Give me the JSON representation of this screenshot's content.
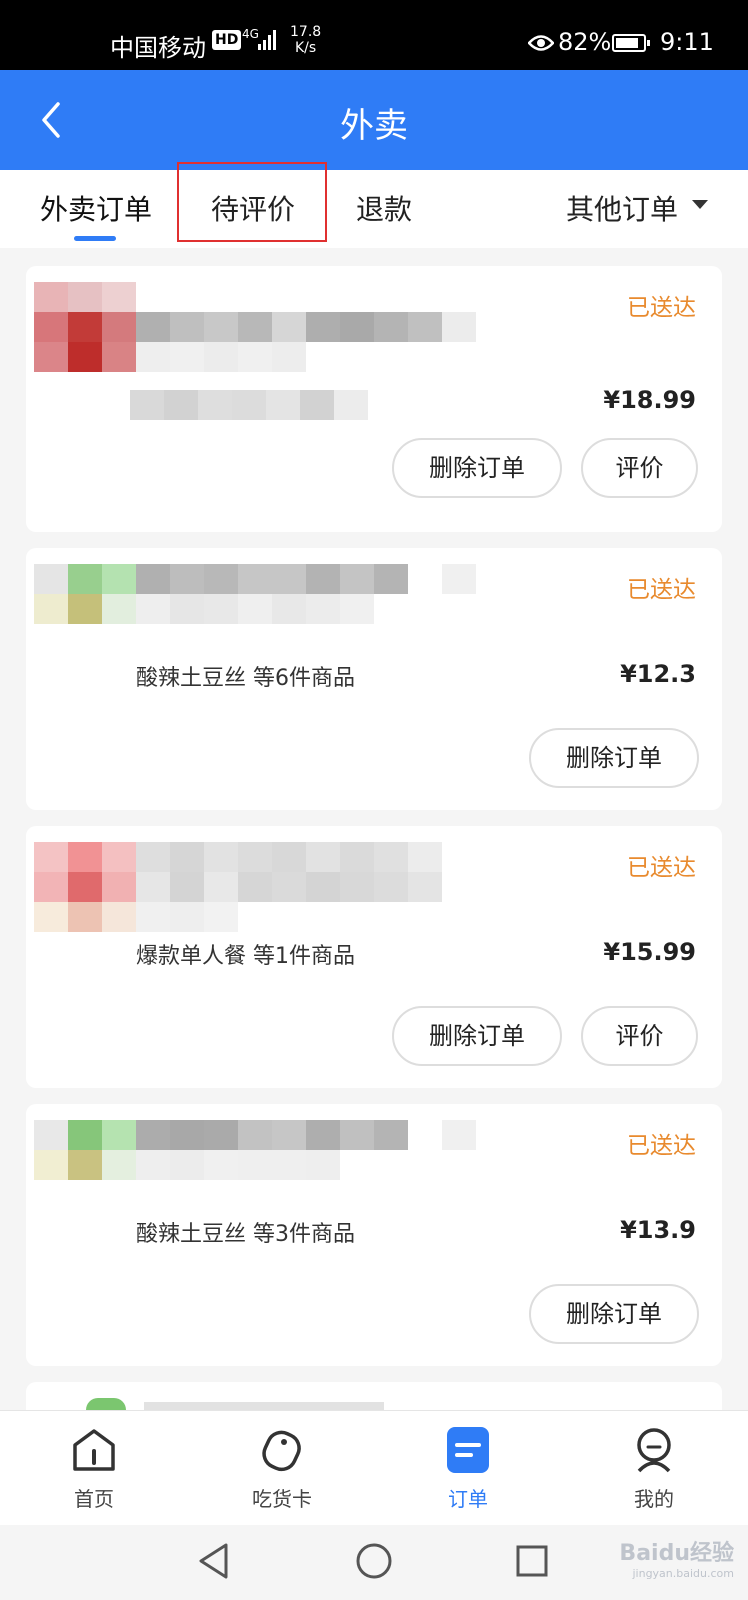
{
  "status_bar": {
    "carrier": "中国移动",
    "hd": "HD",
    "network": "4G",
    "speed_value": "17.8",
    "speed_unit": "K/s",
    "battery": "82%",
    "time": "9:11"
  },
  "header": {
    "title": "外卖"
  },
  "tabs": {
    "items": [
      {
        "label": "外卖订单"
      },
      {
        "label": "待评价"
      },
      {
        "label": "退款"
      }
    ],
    "more_label": "其他订单"
  },
  "orders": [
    {
      "status": "已送达",
      "goods": "",
      "price": "¥18.99",
      "delete_label": "删除订单",
      "review_label": "评价"
    },
    {
      "status": "已送达",
      "goods": "酸辣土豆丝 等6件商品",
      "price": "¥12.3",
      "delete_label": "删除订单"
    },
    {
      "status": "已送达",
      "goods": "爆款单人餐 等1件商品",
      "price": "¥15.99",
      "delete_label": "删除订单",
      "review_label": "评价"
    },
    {
      "status": "已送达",
      "goods": "酸辣土豆丝 等3件商品",
      "price": "¥13.9",
      "delete_label": "删除订单"
    }
  ],
  "bottom_nav": {
    "items": [
      {
        "label": "首页",
        "icon": "home-icon"
      },
      {
        "label": "吃货卡",
        "icon": "card-icon"
      },
      {
        "label": "订单",
        "icon": "order-icon"
      },
      {
        "label": "我的",
        "icon": "profile-icon"
      }
    ],
    "active_index": 2
  },
  "watermark": {
    "brand": "Baidu经验",
    "url": "jingyan.baidu.com"
  },
  "colors": {
    "primary": "#2f7cf6",
    "status": "#e88a2e",
    "highlight": "#e03030"
  }
}
